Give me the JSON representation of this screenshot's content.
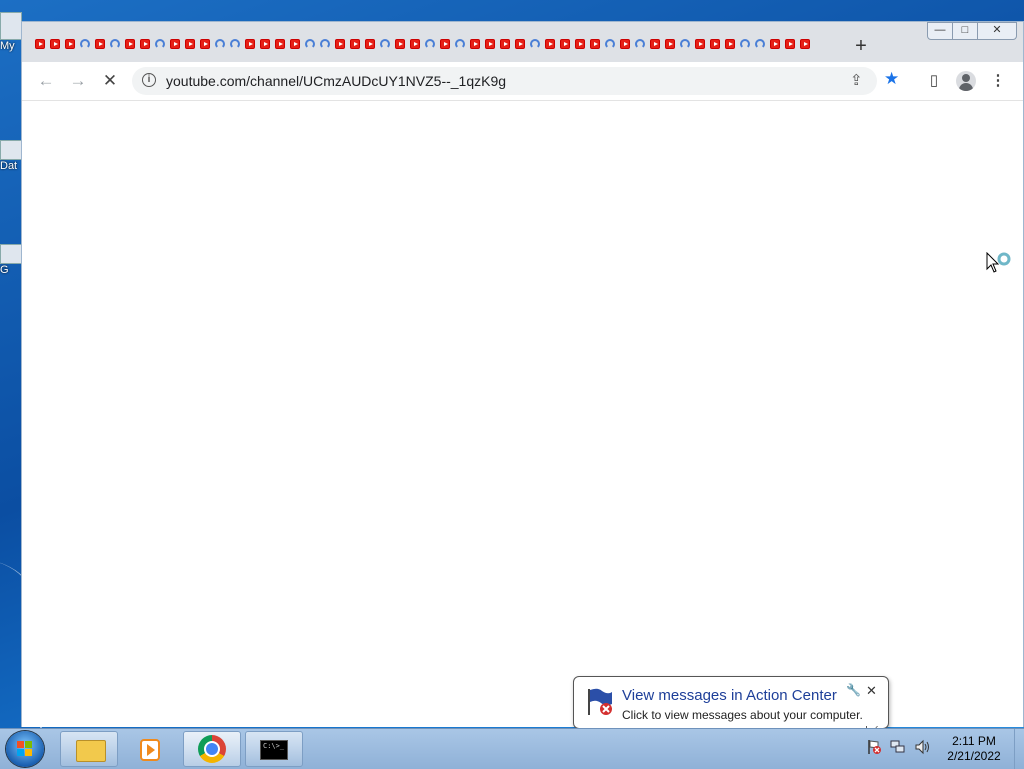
{
  "desktop": {
    "icons": [
      {
        "label": "My"
      },
      {
        "label": "Dat"
      },
      {
        "label": "G"
      }
    ]
  },
  "browser": {
    "tab_count": 52,
    "new_tab_label": "+",
    "address": "youtube.com/channel/UCmzAUDcUY1NVZ5--_1qzK9g",
    "window_controls": {
      "minimize": "—",
      "maximize": "□",
      "close": "✕"
    },
    "nav": {
      "back": "←",
      "forward": "→",
      "stop": "✕"
    },
    "icons": {
      "info": "i",
      "share": "⇪",
      "star": "★",
      "sidepanel": "▯",
      "menu": "⋮"
    },
    "accent": "#1a73e8"
  },
  "notification": {
    "title": "View messages in Action Center",
    "text": "Click to view messages about your computer.",
    "close": "✕",
    "pin": "🔧"
  },
  "taskbar": {
    "clock_time": "2:11 PM",
    "clock_date": "2/21/2022",
    "cmd_prompt": "C:\\>_"
  }
}
